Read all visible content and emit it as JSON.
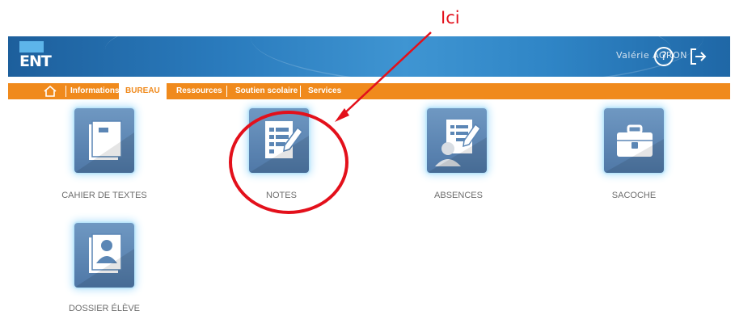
{
  "annotation": {
    "label": "Ici"
  },
  "header": {
    "logo_text": "ENT",
    "user_name": "Valérie AGRON",
    "help_glyph": "?"
  },
  "nav": {
    "items": [
      {
        "label": "Informations"
      },
      {
        "label": "BUREAU",
        "active": true
      },
      {
        "label": "Ressources"
      },
      {
        "label": "Soutien scolaire"
      },
      {
        "label": "Services"
      }
    ]
  },
  "apps": [
    {
      "label": "CAHIER DE TEXTES",
      "icon": "notebook-icon"
    },
    {
      "label": "NOTES",
      "icon": "notes-edit-icon"
    },
    {
      "label": "ABSENCES",
      "icon": "absences-icon"
    },
    {
      "label": "SACOCHE",
      "icon": "briefcase-icon"
    },
    {
      "label": "DOSSIER ÉLÈVE",
      "icon": "student-file-icon"
    }
  ],
  "colors": {
    "header_blue": "#2a7bbd",
    "nav_orange": "#f08a1c",
    "annotation_red": "#e3101b",
    "tile_blue": "#5b86b5"
  }
}
